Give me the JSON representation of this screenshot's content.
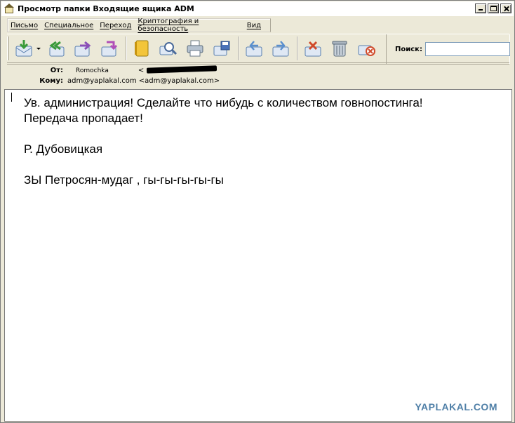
{
  "window": {
    "title": "Просмотр папки Входящие ящика ADM"
  },
  "menubar": {
    "items": [
      {
        "label": "Письмо"
      },
      {
        "label": "Специальное"
      },
      {
        "label": "Переход"
      },
      {
        "label": "Криптография и безопасность"
      },
      {
        "label": "Вид"
      }
    ]
  },
  "toolbar": {
    "buttons": [
      {
        "icon": "get-mail-icon"
      },
      {
        "icon": "reply-all-icon"
      },
      {
        "icon": "forward-icon"
      },
      {
        "icon": "redirect-icon"
      },
      {
        "icon": "address-book-icon"
      },
      {
        "icon": "find-icon"
      },
      {
        "icon": "print-icon"
      },
      {
        "icon": "save-icon"
      },
      {
        "icon": "previous-message-icon"
      },
      {
        "icon": "next-message-icon"
      },
      {
        "icon": "delete-message-icon"
      },
      {
        "icon": "trash-icon"
      },
      {
        "icon": "junk-icon"
      }
    ],
    "search": {
      "label": "Поиск:",
      "value": ""
    }
  },
  "header": {
    "from_label": "От:",
    "from_name": "Romochka",
    "from_address_open": "<",
    "to_label": "Кому:",
    "to_value": "adm@yaplakal.com <adm@yaplakal.com>"
  },
  "message": {
    "body": "Ув. администрация! Сделайте что нибудь с количеством говнопостинга!\nПередача пропадает!\n\nР. Дубовицкая\n\nЗЫ Петросян-мудаг , гы-гы-гы-гы-гы"
  },
  "watermark": {
    "text": "YAPLAKAL.COM"
  },
  "colors": {
    "chrome": "#ece9d8",
    "watermark": "#4f7fa7"
  }
}
